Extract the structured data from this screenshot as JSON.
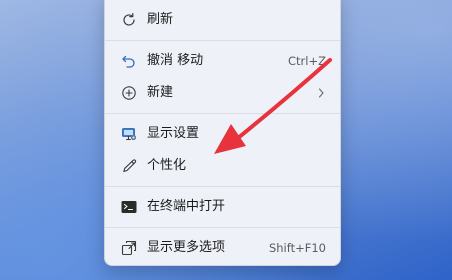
{
  "context_menu": {
    "items": [
      {
        "id": "refresh",
        "label": "刷新",
        "icon": "refresh-icon"
      },
      {
        "id": "undo",
        "label": "撤消 移动",
        "shortcut": "Ctrl+Z",
        "icon": "undo-icon"
      },
      {
        "id": "new",
        "label": "新建",
        "icon": "plus-circle-icon",
        "has_submenu": true
      },
      {
        "id": "display",
        "label": "显示设置",
        "icon": "display-settings-icon"
      },
      {
        "id": "personalize",
        "label": "个性化",
        "icon": "pen-icon"
      },
      {
        "id": "terminal",
        "label": "在终端中打开",
        "icon": "terminal-icon"
      },
      {
        "id": "more",
        "label": "显示更多选项",
        "shortcut": "Shift+F10",
        "icon": "more-options-icon"
      }
    ]
  },
  "annotation": {
    "arrow_color": "#e8323c"
  },
  "colors": {
    "menu_background": "#eef1f8",
    "icon_accent": "#2e6fc0"
  }
}
